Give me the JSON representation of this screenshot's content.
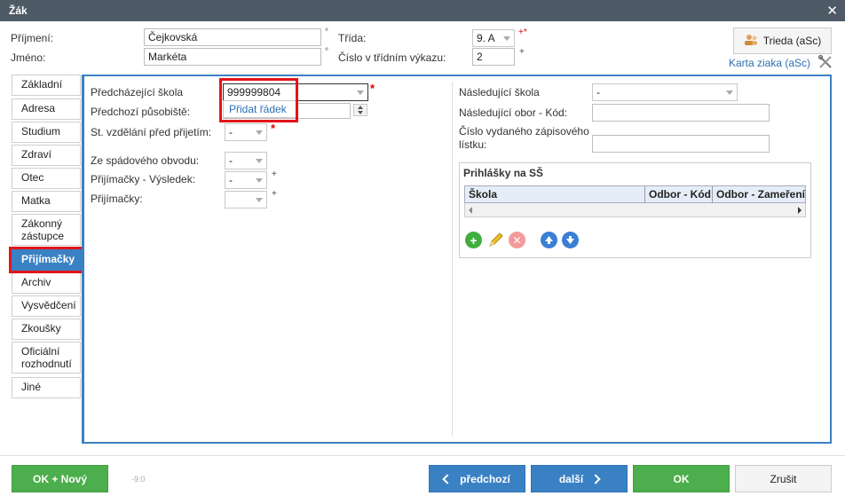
{
  "window": {
    "title": "Žák",
    "close_glyph": "✕"
  },
  "header": {
    "prijmeni_label": "Příjmení:",
    "prijmeni_value": "Čejkovská",
    "jmeno_label": "Jméno:",
    "jmeno_value": "Markéta",
    "trida_label": "Třída:",
    "trida_value": "9. A",
    "trida_marker": "+*",
    "cislo_label": "Číslo v třídním výkazu:",
    "cislo_value": "2",
    "cislo_marker": "+",
    "degree_mark": "°",
    "trieda_button": "Trieda (aSc)",
    "karta_link": "Karta ziaka (aSc)",
    "icons": {
      "trieda": "person-icon",
      "tools": "tools-icon"
    }
  },
  "tabs": [
    {
      "label": "Základní"
    },
    {
      "label": "Adresa"
    },
    {
      "label": "Studium"
    },
    {
      "label": "Zdraví"
    },
    {
      "label": "Otec"
    },
    {
      "label": "Matka"
    },
    {
      "label": "Zákonný zástupce"
    },
    {
      "label": "Přijímačky"
    },
    {
      "label": "Archiv"
    },
    {
      "label": "Vysvědčení"
    },
    {
      "label": "Zkoušky"
    },
    {
      "label": "Oficiální rozhodnutí"
    },
    {
      "label": "Jiné"
    }
  ],
  "active_tab": "Přijímačky",
  "left_form": {
    "predchazejici_skola_label": "Předcházející škola",
    "predchazejici_skola_value": "999999804",
    "dropdown_option": "Přidat řádek",
    "predchozi_pusobiste_label": "Předchozí působiště:",
    "st_vzdelani_label": "St. vzdělání před přijetím:",
    "st_vzdelani_value": "-",
    "ze_spadoveho_label": "Ze spádového obvodu:",
    "ze_spadoveho_value": "-",
    "prijimacky_vysledek_label": "Přijímačky - Výsledek:",
    "prijimacky_vysledek_value": "-",
    "prijimacky_label": "Přijímačky:",
    "prijimacky_value": "",
    "required_mark": "*",
    "plus_mark": "+"
  },
  "right_form": {
    "nasledujici_skola_label": "Následující škola",
    "nasledujici_skola_value": "-",
    "nasledujici_obor_label": "Následující obor - Kód:",
    "nasledujici_obor_value": "",
    "cislo_listku_label": "Číslo vydaného zápisového lístku:",
    "cislo_listku_value": "",
    "prihlasky_title": "Prihlášky na SŠ",
    "grid_columns": [
      "Škola",
      "Odbor - Kód",
      "Odbor - Zameření"
    ],
    "grid_icons": [
      "add-icon",
      "edit-icon",
      "delete-icon",
      "move-up-icon",
      "move-down-icon"
    ]
  },
  "footer": {
    "ok_novy": "OK + Nový",
    "small_text": "-9:0",
    "predchozi": "předchozí",
    "dalsi": "další",
    "ok": "OK",
    "zrusit": "Zrušit"
  },
  "colors": {
    "accent": "#3a81c4",
    "green": "#4cae4c",
    "title_bar": "#4e5a66",
    "highlight": "#e3141b",
    "required": "#dd0000"
  }
}
